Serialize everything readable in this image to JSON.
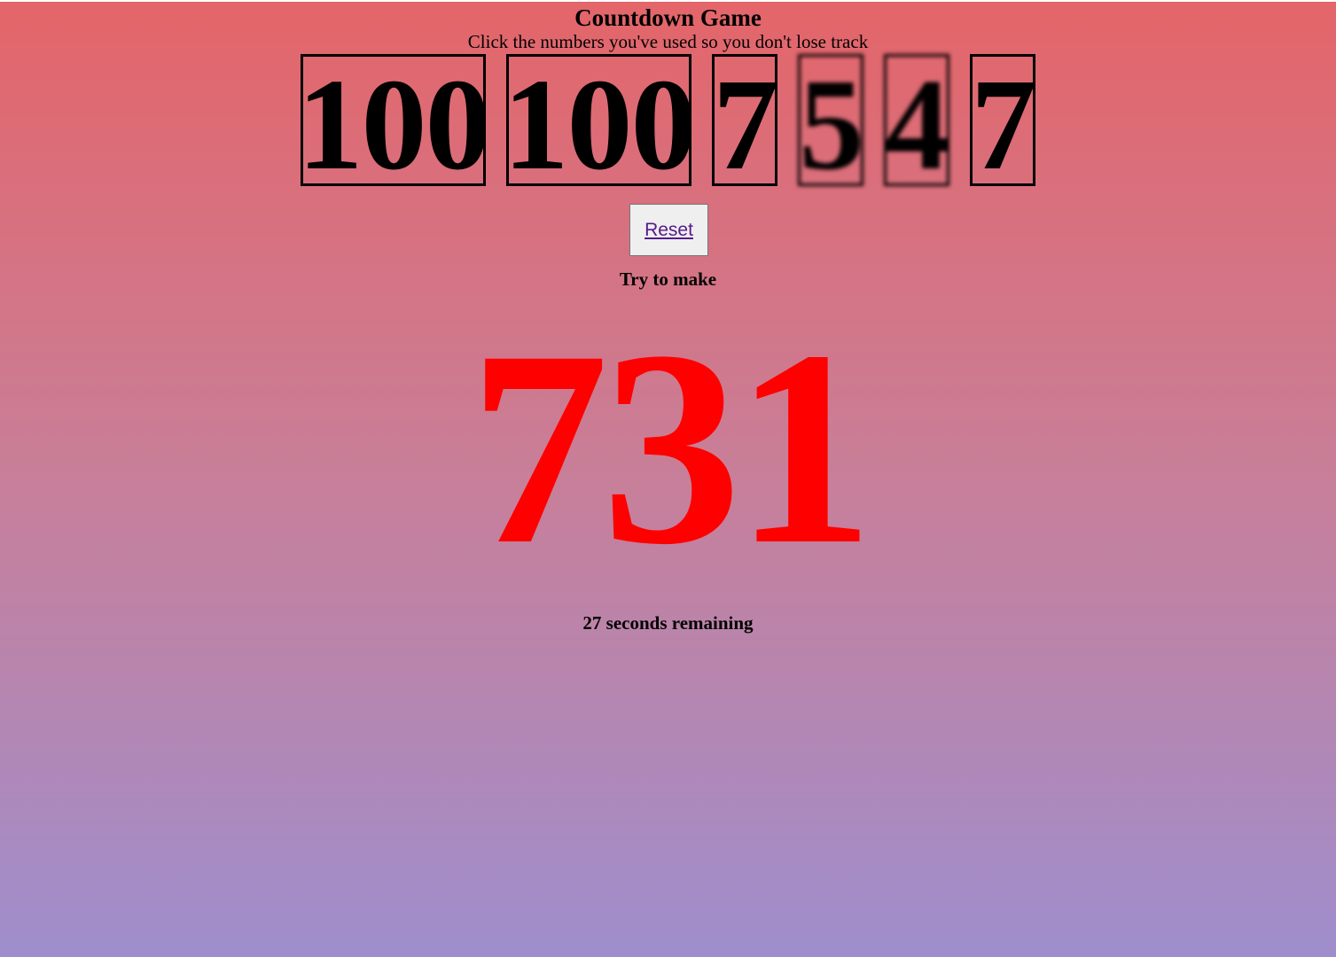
{
  "game": {
    "title": "Countdown Game",
    "subtitle": "Click the numbers you've used so you don't lose track"
  },
  "numbers": [
    {
      "value": "100",
      "used": false
    },
    {
      "value": "100",
      "used": false
    },
    {
      "value": "7",
      "used": false
    },
    {
      "value": "5",
      "used": true
    },
    {
      "value": "4",
      "used": true
    },
    {
      "value": "7",
      "used": false
    }
  ],
  "controls": {
    "reset_label": "Reset"
  },
  "target": {
    "label": "Try to make",
    "value": "731",
    "color": "#ff0000"
  },
  "timer": {
    "text": "27 seconds remaining"
  },
  "colors": {
    "gradient_top": "#e46569",
    "gradient_bottom": "#9f8ecd",
    "link": "#551a8b"
  }
}
